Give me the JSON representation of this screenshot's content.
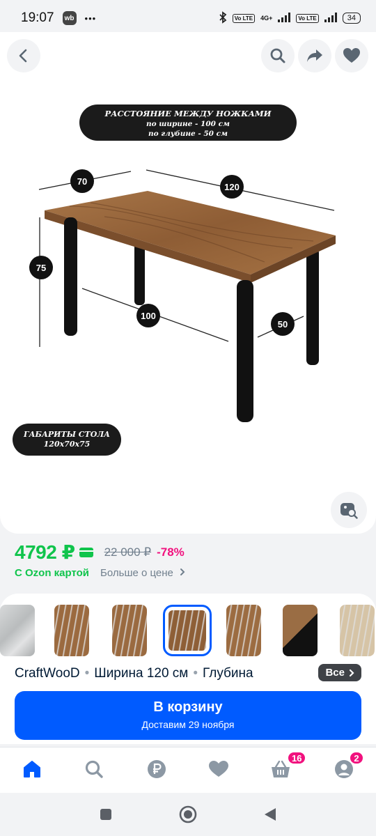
{
  "status_bar": {
    "time": "19:07",
    "app_badge": "wb",
    "more": "•••",
    "network_lte_1": "Vo LTE",
    "network_4g": "4G+",
    "network_lte_2": "Vo LTE",
    "battery": "34"
  },
  "product_image": {
    "spec_top_title": "РАССТОЯНИЕ МЕЖДУ НОЖКАМИ",
    "spec_top_line1": "по ширине - 100 см",
    "spec_top_line2": "по глубине - 50 см",
    "spec_bottom_title": "ГАБАРИТЫ СТОЛА",
    "spec_bottom_size": "120х70х75",
    "dim_width": "120",
    "dim_depth": "70",
    "dim_height": "75",
    "dim_leg_width": "100",
    "dim_leg_depth": "50"
  },
  "price": {
    "current": "4792 ₽",
    "old": "22 000 ₽",
    "discount": "-78%",
    "ozon_card": "С Ozon картой",
    "more_about_price": "Больше о цене"
  },
  "variants": {
    "colors": [
      "#b9bcbd",
      "#9b6a3f",
      "#9a6a40",
      "#8e5f37",
      "#9c6c41",
      "#9a6d44",
      "#d6c4a6"
    ],
    "selected_index": 3
  },
  "description": {
    "brand": "CraftWooD",
    "width": "Ширина 120 см",
    "depth": "Глубина",
    "all_label": "Все"
  },
  "cart_button": {
    "title": "В корзину",
    "subtitle": "Доставим 29 ноября"
  },
  "bottom_nav": {
    "cart_badge": "16",
    "profile_badge": "2"
  },
  "colors": {
    "ozon_blue": "#005bff",
    "price_green": "#10c44c",
    "discount_pink": "#f1117e"
  }
}
